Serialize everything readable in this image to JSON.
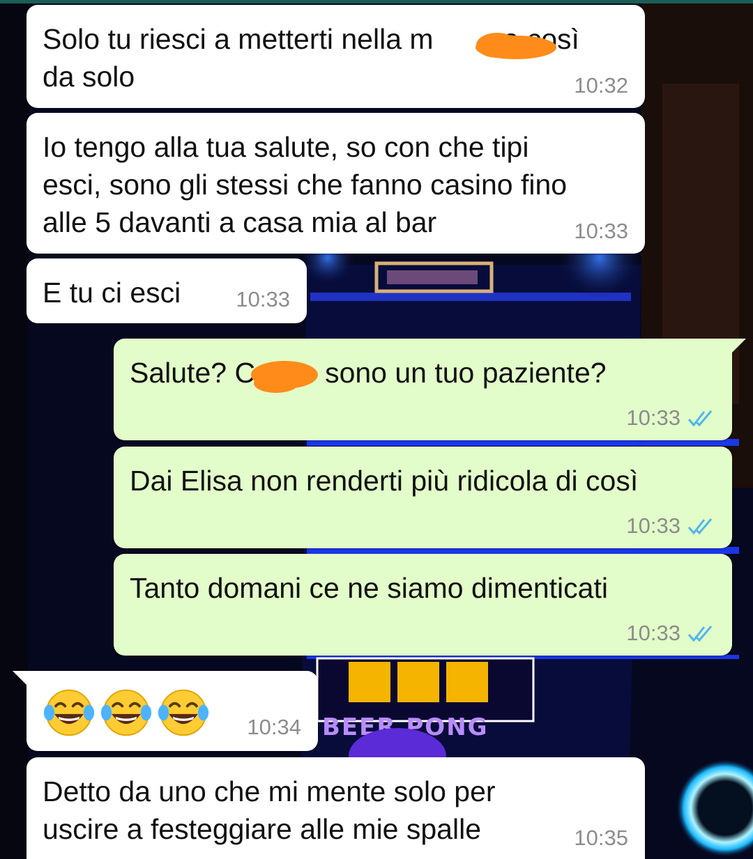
{
  "theme": {
    "incoming_bubble": "#ffffff",
    "outgoing_bubble": "#e2fdc9",
    "read_tick_color": "#4fb6ec",
    "timestamp_color": "#8c8c8c",
    "redaction_color": "#ff8c1a"
  },
  "background": {
    "description_icon": "beer-pong-table-wallpaper",
    "sign_text": "BEER PONG"
  },
  "messages": [
    {
      "direction": "incoming",
      "lines": [
        "Solo tu riesci a metterti nella m",
        "a così",
        "da solo"
      ],
      "time": "10:32"
    },
    {
      "direction": "incoming",
      "text": "Io tengo alla tua salute, so con che tipi\nesci, sono gli stessi che fanno casino fino\nalle 5 davanti a casa mia al bar",
      "time": "10:33"
    },
    {
      "direction": "incoming",
      "text": "E tu ci esci",
      "time": "10:33"
    },
    {
      "direction": "outgoing",
      "parts": [
        "Salute? C",
        "sono un tuo paziente?"
      ],
      "time": "10:33",
      "status": "read"
    },
    {
      "direction": "outgoing",
      "text": "Dai Elisa non renderti più ridicola di così",
      "time": "10:33",
      "status": "read"
    },
    {
      "direction": "outgoing",
      "text": "Tanto domani ce ne siamo dimenticati",
      "time": "10:33",
      "status": "read"
    },
    {
      "direction": "incoming",
      "emoji": [
        "face-with-tears-of-joy",
        "face-with-tears-of-joy",
        "face-with-tears-of-joy"
      ],
      "time": "10:34"
    },
    {
      "direction": "incoming",
      "text": "Detto da uno che mi mente solo per\nuscire a festeggiare alle mie spalle",
      "time": "10:35"
    }
  ]
}
